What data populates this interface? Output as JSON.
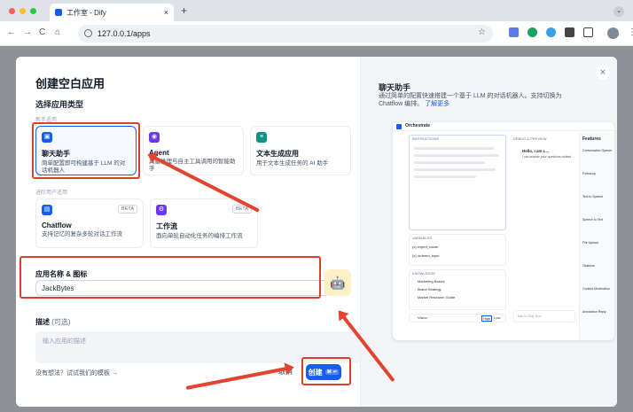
{
  "browser": {
    "tab_title": "工作室 - Dify",
    "new_tab": "+",
    "url": "127.0.0.1/apps",
    "back": "←",
    "forward": "→",
    "reload": "C",
    "home": "⌂"
  },
  "modal": {
    "title": "创建空白应用",
    "section_type": "选择应用类型",
    "caption_beginner": "新手适用",
    "caption_advanced": "进阶用户适用",
    "cards": [
      {
        "title": "聊天助手",
        "desc": "简单配置即可构建基于 LLM 的对话机器人",
        "color": "#155eef"
      },
      {
        "title": "Agent",
        "desc": "具备推理与自主工具调用的智能助手",
        "color": "#6938ef"
      },
      {
        "title": "文本生成应用",
        "desc": "用于文本生成任务的 AI 助手",
        "color": "#0e9384"
      },
      {
        "title": "Chatflow",
        "desc": "支持记忆的复杂多轮对话工作流",
        "color": "#155eef",
        "badge": "BETA"
      },
      {
        "title": "工作流",
        "desc": "面向单轮自动化任务的编排工作流",
        "color": "#6938ef",
        "badge": "BETA"
      }
    ],
    "name_label": "应用名称 & 图标",
    "name_value": "JackBytes",
    "desc_label": "描述",
    "desc_optional": "(可选)",
    "desc_placeholder": "输入应用的描述",
    "template_link": "没有想法？试试我们的模板 →",
    "cancel_label": "取消",
    "create_label": "创建",
    "create_shortcut": "⌘ ↵",
    "close": "×"
  },
  "preview": {
    "title": "聊天助手",
    "desc": "通过简单的配置快速搭建一个基于 LLM 的对话机器人。支持切换为 Chatflow 编排。",
    "learn_more": "了解更多",
    "mock": {
      "header": "Orchestrate",
      "instructions": "INSTRUCTIONS",
      "debug": "DEBUG & PREVIEW",
      "variables": "VARIABLES",
      "knowledge": "KNOWLEDGE",
      "features": "Features",
      "add": "+ Add",
      "var_items": [
        "{x} expert_name",
        "{x} ordered_input"
      ],
      "kb_items": [
        "Marketing Basics",
        "Brand Strategy",
        "Market Research Guide"
      ],
      "vision": "Vision",
      "resolution": "RESOLUTION",
      "high": "High",
      "low": "Low",
      "feature_items": [
        "Conversation Opener",
        "Follow-up",
        "Text to Speech",
        "Speech to Text",
        "File Upload",
        "Citations",
        "Content Moderation",
        "Annotation Reply"
      ],
      "chat_greeting": "Hello, I am L...",
      "chat_sub": "I can answer your questions related",
      "talk_placeholder": "Talk to Dify Bot"
    }
  }
}
